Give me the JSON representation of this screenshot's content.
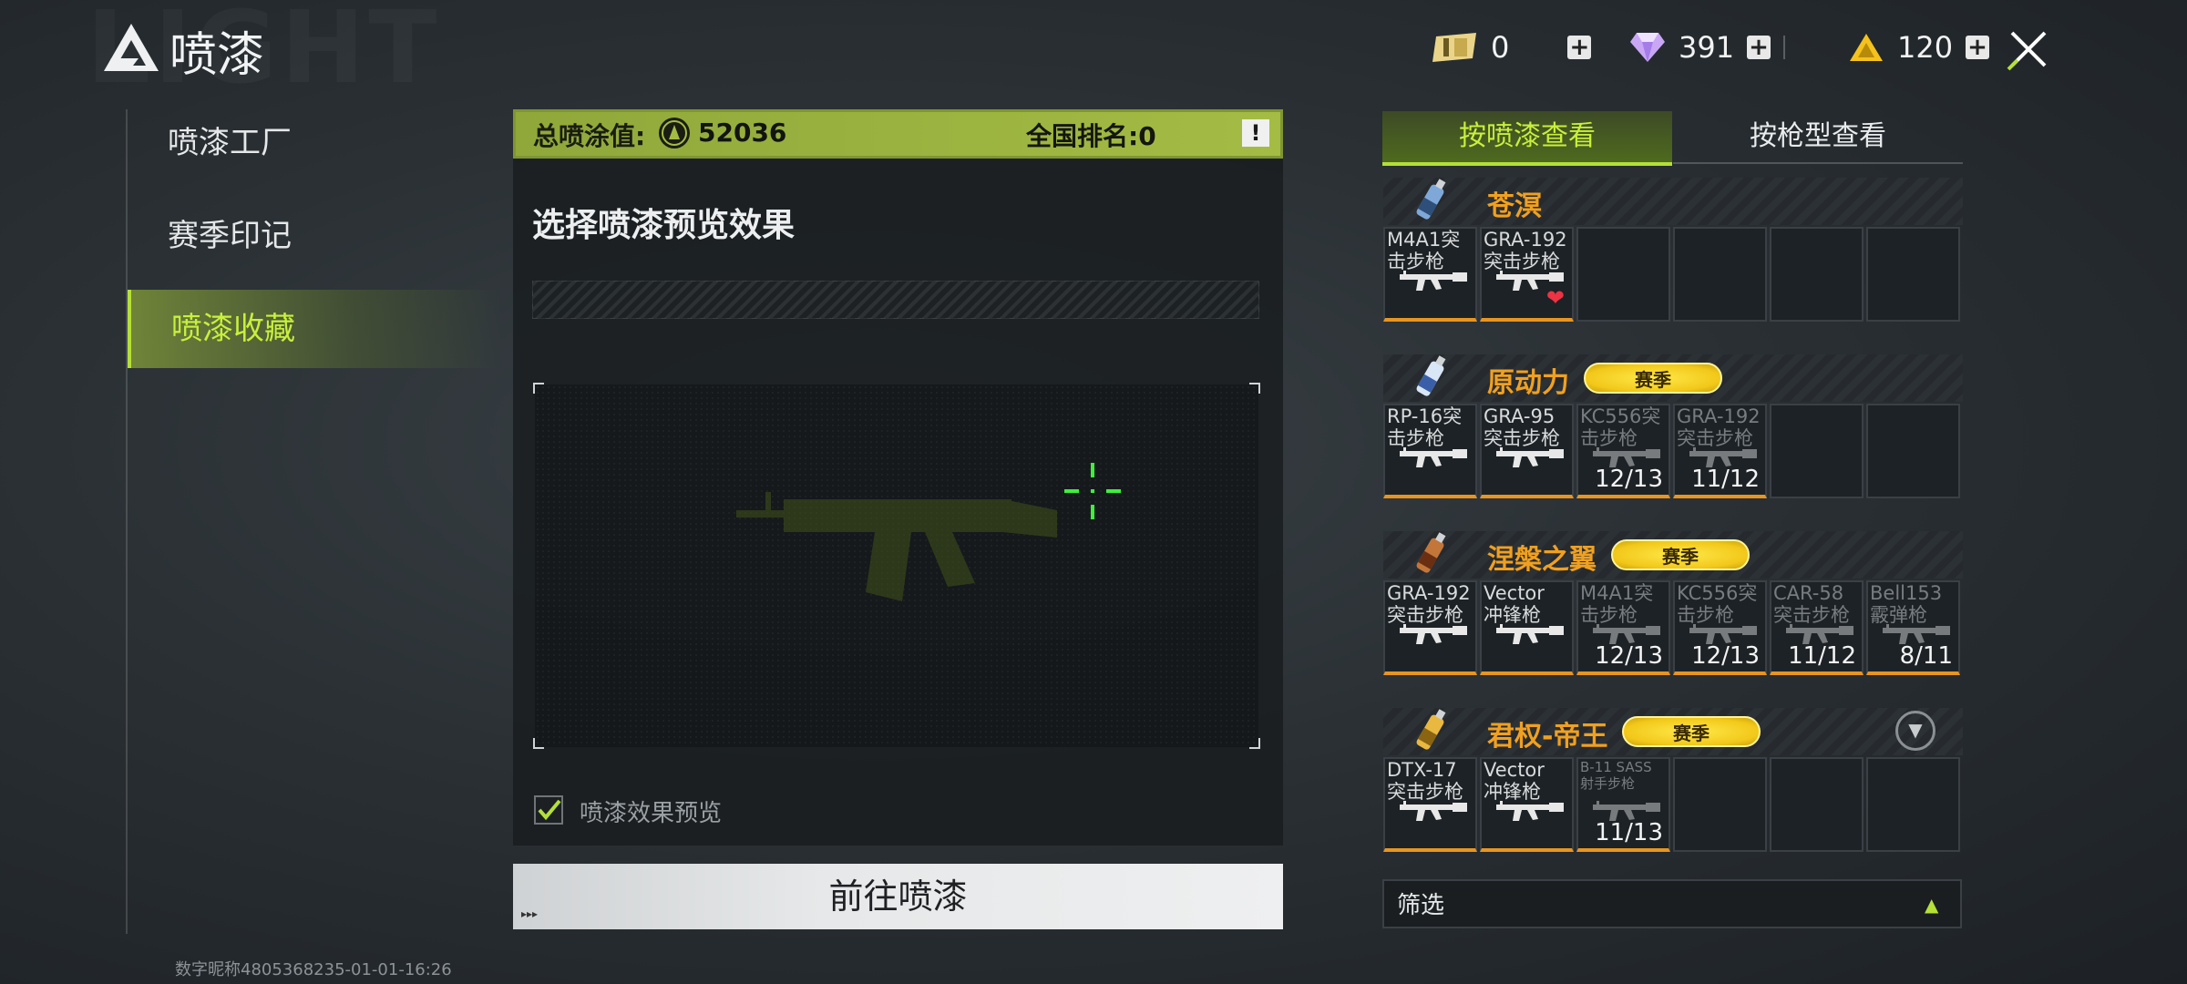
{
  "header": {
    "title": "喷漆",
    "watermark": "LIGHT",
    "currencies": [
      {
        "icon": "ticket-icon",
        "value": "0"
      },
      {
        "icon": "diamond-icon",
        "value": "391"
      },
      {
        "icon": "gold-triangle-icon",
        "value": "120"
      }
    ]
  },
  "nav": {
    "items": [
      {
        "label": "喷漆工厂",
        "active": false
      },
      {
        "label": "赛季印记",
        "active": false
      },
      {
        "label": "喷漆收藏",
        "active": true
      }
    ]
  },
  "score": {
    "label": "总喷涂值:",
    "value": "52036",
    "rank_label": "全国排名:0",
    "info": "!"
  },
  "preview": {
    "title": "选择喷漆预览效果",
    "checkbox_label": "喷漆效果预览",
    "checked": true
  },
  "go_button": "前往喷漆",
  "go_button_deco": "▸▸▸",
  "user_id": "数字昵称4805368235-01-01-16:26",
  "tabs": [
    {
      "label": "按喷漆查看",
      "active": true
    },
    {
      "label": "按枪型查看",
      "active": false
    }
  ],
  "groups": [
    {
      "name": "苍溟",
      "badge": "",
      "cells": [
        {
          "l1": "M4A1突",
          "l2": "击步枪",
          "dim": false,
          "prog": "",
          "heart": false
        },
        {
          "l1": "GRA-192",
          "l2": "突击步枪",
          "dim": false,
          "prog": "",
          "heart": true
        },
        null,
        null,
        null,
        null
      ]
    },
    {
      "name": "原动力",
      "badge": "赛季",
      "cells": [
        {
          "l1": "RP-16突",
          "l2": "击步枪",
          "dim": false,
          "prog": "",
          "heart": false
        },
        {
          "l1": "GRA-95",
          "l2": "突击步枪",
          "dim": false,
          "prog": "",
          "heart": false
        },
        {
          "l1": "KC556突",
          "l2": "击步枪",
          "dim": true,
          "prog": "12/13",
          "heart": false
        },
        {
          "l1": "GRA-192",
          "l2": "突击步枪",
          "dim": true,
          "prog": "11/12",
          "heart": false
        },
        null,
        null
      ]
    },
    {
      "name": "涅槃之翼",
      "badge": "赛季",
      "cells": [
        {
          "l1": "GRA-192",
          "l2": "突击步枪",
          "dim": false,
          "prog": "",
          "heart": false
        },
        {
          "l1": "Vector",
          "l2": "冲锋枪",
          "dim": false,
          "prog": "",
          "heart": false
        },
        {
          "l1": "M4A1突",
          "l2": "击步枪",
          "dim": true,
          "prog": "12/13",
          "heart": false
        },
        {
          "l1": "KC556突",
          "l2": "击步枪",
          "dim": true,
          "prog": "12/13",
          "heart": false
        },
        {
          "l1": "CAR-58",
          "l2": "突击步枪",
          "dim": true,
          "prog": "11/12",
          "heart": false
        },
        {
          "l1": "Bell153",
          "l2": "霰弹枪",
          "dim": true,
          "prog": "8/11",
          "heart": false
        }
      ]
    },
    {
      "name": "君权-帝王",
      "badge": "赛季",
      "cells": [
        {
          "l1": "DTX-17",
          "l2": "突击步枪",
          "dim": false,
          "prog": "",
          "heart": false
        },
        {
          "l1": "Vector",
          "l2": "冲锋枪",
          "dim": false,
          "prog": "",
          "heart": false
        },
        {
          "l1": "B-11 SASS",
          "l2": "射手步枪",
          "dim": true,
          "small": true,
          "prog": "11/13",
          "heart": false
        },
        null,
        null,
        null
      ]
    }
  ],
  "filter": {
    "label": "筛选",
    "arrow": "▲"
  },
  "colors": {
    "accent": "#b4e038",
    "orange": "#f0a020",
    "badge": "#f2c81a"
  }
}
